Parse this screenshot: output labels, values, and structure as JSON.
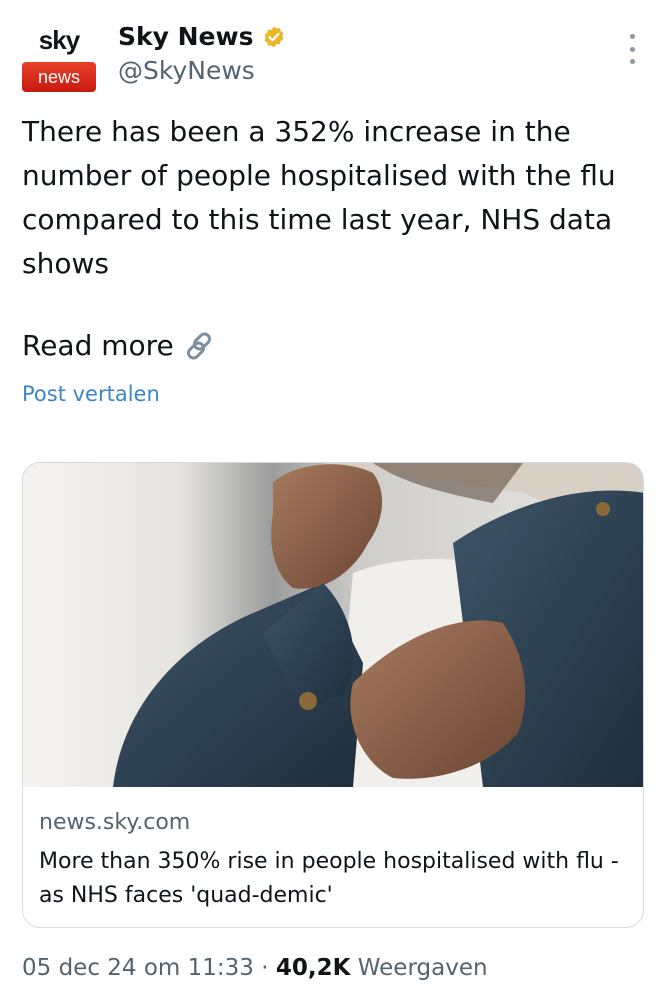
{
  "author": {
    "display_name": "Sky News",
    "handle": "@SkyNews",
    "avatar_top_text": "sky",
    "avatar_bottom_text": "news",
    "verified_icon": "verified-gold-badge-icon"
  },
  "tweet": {
    "text": "There has been a 352% increase in the number of people hospitalised with the flu compared to this time last year, NHS data shows",
    "read_more": "Read more",
    "translate_label": "Post vertalen"
  },
  "card": {
    "domain": "news.sky.com",
    "title": "More than 350% rise in people hospitalised with flu - as NHS faces 'quad-demic'"
  },
  "meta": {
    "timestamp": "05 dec 24 om 11:33",
    "separator": "·",
    "views_count": "40,2K",
    "views_label": "Weergaven"
  },
  "colors": {
    "accent_link": "#3d86c6",
    "secondary_text": "#536471",
    "brand_red": "#d9261c"
  }
}
